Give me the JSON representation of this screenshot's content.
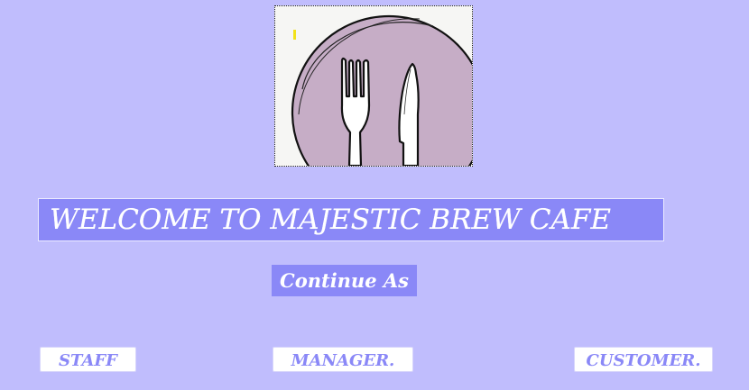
{
  "welcome": {
    "title": "WELCOME TO MAJESTIC BREW CAFE"
  },
  "prompt": {
    "continue_label": "Continue As"
  },
  "roles": {
    "staff_label": "STAFF",
    "manager_label": "MANAGER.",
    "customer_label": "CUSTOMER."
  },
  "logo": {
    "icon": "fork-knife-plate-icon"
  },
  "colors": {
    "background": "#c0bdfd",
    "accent": "#8a88f7",
    "plate": "#c6adc6",
    "button_bg": "#ffffff"
  }
}
